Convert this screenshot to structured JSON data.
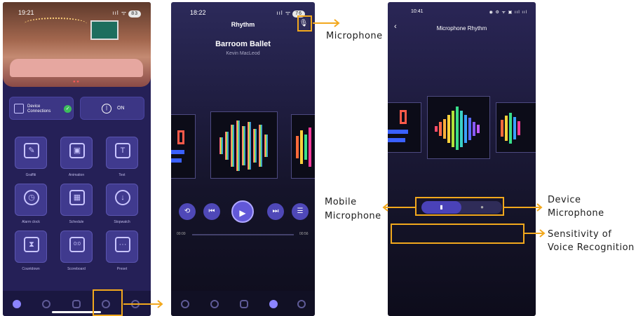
{
  "colors": {
    "accent_annotation": "#f2a81d",
    "app_background": "#252057",
    "primary_button": "#4f48b8"
  },
  "phone1": {
    "time": "19:21",
    "status_icons": "ııl ᯤ",
    "battery": "83",
    "device_connections_label": "Device Connections",
    "power_label": "ON",
    "tiles": [
      {
        "icon": "graffiti-icon",
        "label": "Graffiti"
      },
      {
        "icon": "animation-icon",
        "label": "Animation"
      },
      {
        "icon": "text-icon",
        "label": "Text",
        "glyph": "T"
      },
      {
        "icon": "alarm-clock-icon",
        "label": "Alarm clock"
      },
      {
        "icon": "schedule-icon",
        "label": "Schedule"
      },
      {
        "icon": "stopwatch-icon",
        "label": "Stopwatch"
      },
      {
        "icon": "countdown-icon",
        "label": "Countdown"
      },
      {
        "icon": "scoreboard-icon",
        "label": "Scoreboard",
        "glyph": "0:0"
      },
      {
        "icon": "preset-icon",
        "label": "Preset",
        "glyph": "···"
      }
    ]
  },
  "phone2": {
    "time": "18:22",
    "status_icons": "ııl ᯤ",
    "battery": "76",
    "title": "Rhythm",
    "song_title": "Barroom Ballet",
    "artist": "Kevin MacLeod",
    "time_elapsed": "00:00",
    "time_total": "00:56"
  },
  "phone3": {
    "time": "10:41",
    "status_icons": "◉ ⚙ ᯤ ▣ ııl ııl",
    "title": "Microphone Rhythm"
  },
  "annotations": {
    "microphone": "Microphone",
    "mobile_microphone_line1": "Mobile",
    "mobile_microphone_line2": "Microphone",
    "device_microphone_line1": "Device",
    "device_microphone_line2": "Microphone",
    "sensitivity_line1": "Sensitivity of",
    "sensitivity_line2": "Voice Recognition"
  }
}
